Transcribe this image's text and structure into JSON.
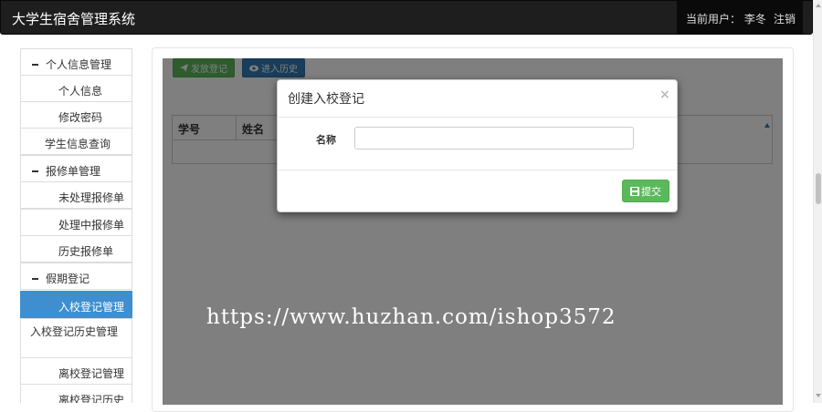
{
  "navbar": {
    "brand": "大学生宿舍管理系统",
    "user_label": "当前用户：  李冬",
    "logout": "注销"
  },
  "sidebar": {
    "items": [
      {
        "label": "个人信息管理",
        "type": "group"
      },
      {
        "label": "个人信息",
        "type": "sub"
      },
      {
        "label": "修改密码",
        "type": "sub"
      },
      {
        "label": "学生信息查询",
        "type": "mid"
      },
      {
        "label": "报修单管理",
        "type": "group"
      },
      {
        "label": "未处理报修单",
        "type": "sub"
      },
      {
        "label": "处理中报修单",
        "type": "sub"
      },
      {
        "label": "历史报修单",
        "type": "sub"
      },
      {
        "label": "假期登记",
        "type": "group"
      },
      {
        "label": "入校登记管理",
        "type": "sub",
        "active": true
      },
      {
        "label": "入校登记历史管理",
        "type": "wrap"
      },
      {
        "label": "离校登记管理",
        "type": "sub"
      },
      {
        "label": "离校登记历史",
        "type": "sub"
      }
    ]
  },
  "toolbar": {
    "register_label": "发放登记",
    "history_label": "进入历史"
  },
  "table": {
    "columns": [
      "学号",
      "姓名"
    ]
  },
  "modal": {
    "title": "创建入校登记",
    "close": "×",
    "field_label": "名称",
    "field_value": "",
    "submit_label": "提交"
  },
  "watermark": "https://www.huzhan.com/ishop3572",
  "colors": {
    "navbar": "#1e1e1e",
    "active": "#3e8ed0",
    "success": "#5cb85c",
    "primary": "#337ab7"
  },
  "icons": {
    "group_toggle": "minus-icon",
    "register": "send-icon",
    "history": "eye-icon",
    "submit": "save-icon",
    "sort": "sort-up-icon"
  }
}
